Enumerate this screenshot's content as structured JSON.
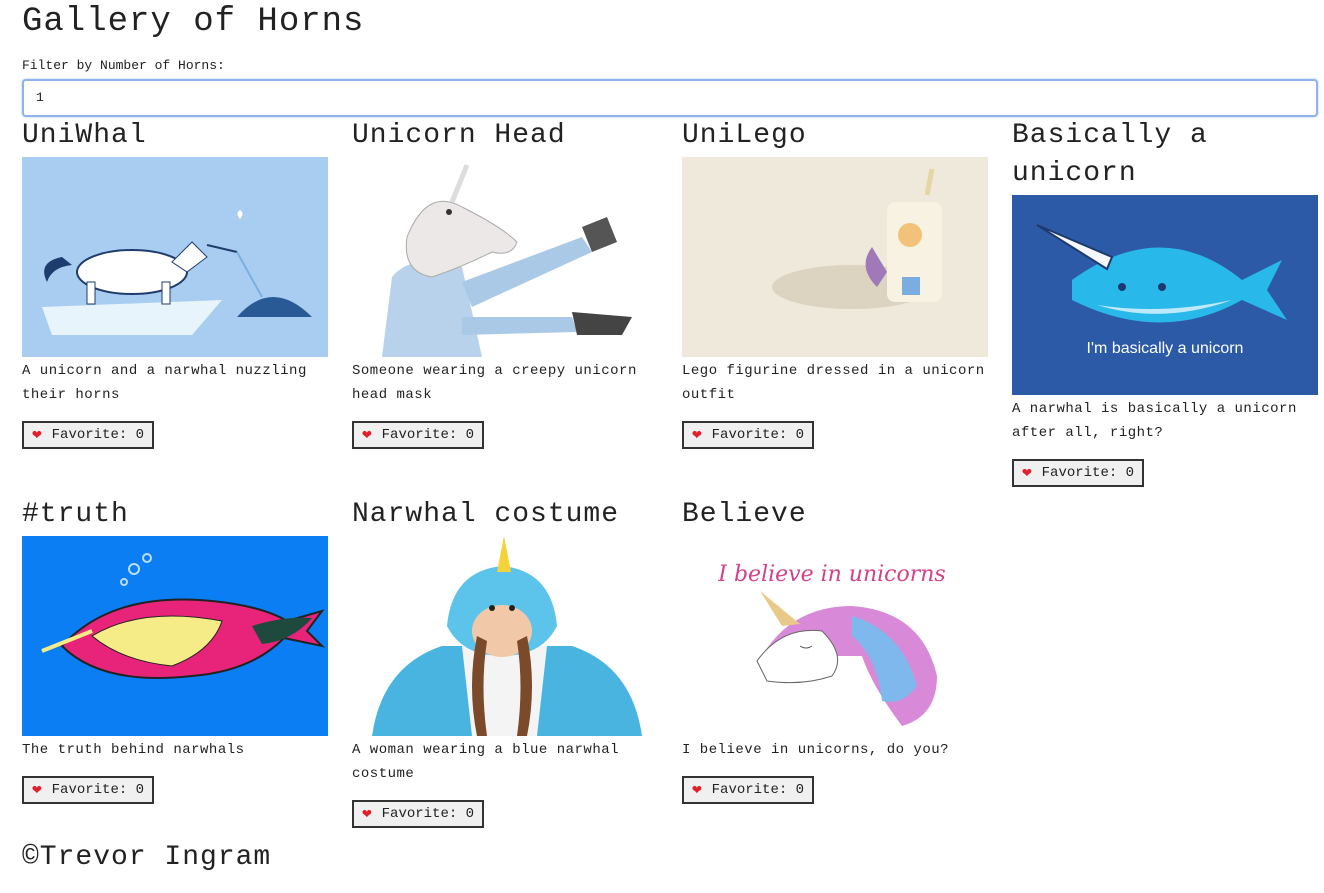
{
  "page": {
    "title": "Gallery of Horns",
    "filter_label": "Filter by Number of Horns:",
    "filter_value": "1",
    "footer": "©Trevor Ingram"
  },
  "cards": [
    {
      "title": "UniWhal",
      "description": "A unicorn and a narwhal nuzzling their horns",
      "favorite_label": "Favorite: 0",
      "image": "unicorn-narwhal-illustration"
    },
    {
      "title": "Unicorn Head",
      "description": "Someone wearing a creepy unicorn head mask",
      "favorite_label": "Favorite: 0",
      "image": "unicorn-head-mask-photo"
    },
    {
      "title": "UniLego",
      "description": "Lego figurine dressed in a unicorn outfit",
      "favorite_label": "Favorite: 0",
      "image": "lego-unicorn-photo"
    },
    {
      "title": "Basically a unicorn",
      "description": "A narwhal is basically a unicorn after all, right?",
      "favorite_label": "Favorite: 0",
      "image": "cartoon-narwhal",
      "image_caption": "I'm basically a unicorn"
    },
    {
      "title": "#truth",
      "description": "The truth behind narwhals",
      "favorite_label": "Favorite: 0",
      "image": "narwhal-xray-illustration"
    },
    {
      "title": "Narwhal costume",
      "description": "A woman wearing a blue narwhal costume",
      "favorite_label": "Favorite: 0",
      "image": "narwhal-costume-photo"
    },
    {
      "title": "Believe",
      "description": "I believe in unicorns, do you?",
      "favorite_label": "Favorite: 0",
      "image": "believe-unicorn-watercolor",
      "image_caption": "I believe in unicorns"
    }
  ],
  "colors": {
    "focus_border": "#8fb3ea",
    "heart": "#e0202a"
  }
}
